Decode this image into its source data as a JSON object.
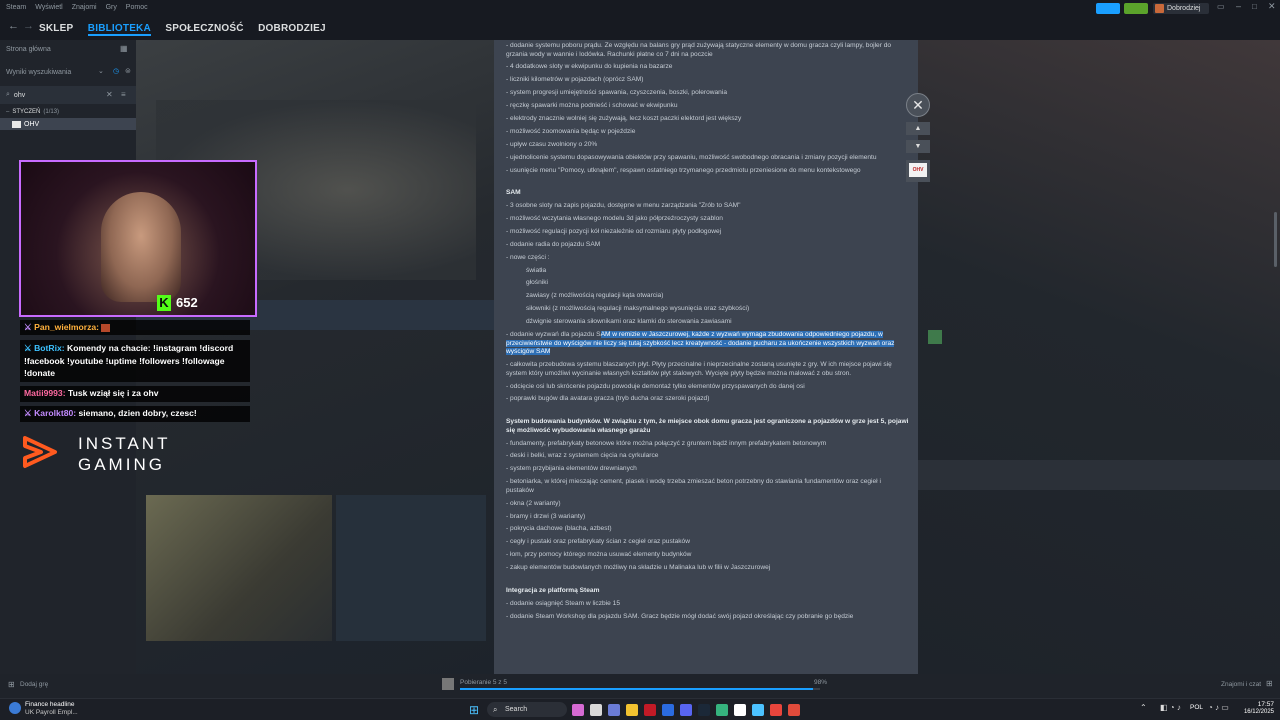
{
  "titlebar": {
    "menu": [
      "Steam",
      "Wyświetl",
      "Znajomi",
      "Gry",
      "Pomoc"
    ],
    "user": "Dobrodziej"
  },
  "nav": {
    "tabs": [
      "SKLEP",
      "BIBLIOTEKA",
      "SPOŁECZNOŚĆ",
      "DOBRODZIEJ"
    ]
  },
  "sidebar": {
    "home": "Strona główna",
    "results": "Wyniki wyszukiwania",
    "search_value": "ohv",
    "group": "STYCZEŃ",
    "group_count": "(1/13)",
    "game": "OHV",
    "add_game": "Dodaj grę"
  },
  "doc": {
    "lines1": [
      "- dodanie systemu poboru prądu. Ze względu na balans gry prąd zużywają statyczne elementy w domu gracza czyli lampy, bojler do grzania wody w wannie i lodówka. Rachunki płatne co 7 dni na poczcie",
      "- 4 dodatkowe sloty w ekwipunku do kupienia na bazarze",
      "- liczniki kilometrów w pojazdach (oprócz SAM)",
      "- system progresji umiejętności spawania, czyszczenia, boszki, polerowania",
      "- ręczkę spawarki można podnieść i schować w ekwipunku",
      "- elektrody znacznie wolniej się zużywają, lecz koszt paczki elektord jest większy",
      "- możliwość zoomowania będąc w pojeździe",
      "- upływ czasu zwolniony o 20%",
      "- ujednolicenie systemu dopasowywania obiektów przy spawaniu, możliwość swobodnego obracania i zmiany pozycji elementu",
      "- usunięcie menu \"Pomocy, utknąłem\", respawn ostatniego trzymanego przedmiotu przeniesione do menu kontekstowego"
    ],
    "head_sam": "SAM",
    "lines_sam": [
      "- 3 osobne sloty na zapis pojazdu, dostępne w menu zarządzania \"Zrób to SAM\"",
      "- możliwość wczytania własnego modelu 3d jako półprzeźroczysty szablon",
      "- możliwość regulacji pozycji kół niezależnie od rozmiaru płyty podłogowej",
      "- dodanie radia do pojazdu SAM",
      "- nowe części :"
    ],
    "sub_items": [
      "światła",
      "głośniki",
      "zawiasy (z możliwością regulacji kąta otwarcia)",
      "siłowniki (z możliwością regulacji maksymalnego wysunięcia oraz szybkości)",
      "dźwignie sterowania siłownikami oraz klamki do sterowania zawiasami"
    ],
    "sel_pre": "- dodanie wyzwań dla pojazdu S",
    "sel_text": "AM w remizie w Jaszczurowej, każde z wyzwań wymaga zbudowania odpowiedniego pojazdu, w przeciwieństwie do wyścigów nie liczy się tutaj szybkość lecz kreatywność - dodanie pucharu za ukończenie wszystkich wyzwań oraz wyścigów SAM",
    "lines2": [
      "- całkowita przebudowa systemu blaszanych płyt. Płyty przecinalne i nieprzecinalne zostaną usunięte z gry. W ich miejsce pojawi się system który umożliwi wycinanie własnych kształtów płyt stalowych. Wycięte płyty będzie można malować z obu stron.",
      "- odcięcie osi lub skrócenie pojazdu powoduje demontaż tylko elementów przyspawanych do danej osi",
      "- poprawki bugów dla avatara gracza (tryb ducha oraz szeroki pojazd)"
    ],
    "head_build": "System budowania budynków. W związku z tym, że miejsce obok domu gracza jest ograniczone a pojazdów w grze jest 5, pojawi się możliwość wybudowania własnego garażu",
    "lines_build": [
      "- fundamenty, prefabrykaty betonowe które można połączyć z gruntem bądź innym prefabrykatem betonowym",
      "- deski i belki, wraz z systemem cięcia na cyrkularce",
      "- system przybijania elementów drewnianych",
      "- betoniarka, w której mieszając cement, piasek i wodę trzeba zmieszać beton potrzebny do stawiania fundamentów oraz cegieł i pustaków",
      "- okna (2 warianty)",
      "- bramy i drzwi (3 warianty)",
      "- pokrycia dachowe (blacha, azbest)",
      "- cegły i pustaki oraz prefabrykaty ścian z cegieł oraz pustaków",
      "- łom, przy pomocy którego można usuwać elementy budynków",
      "- zakup elementów budowlanych możliwy na składzie u Malinaka lub w filii w Jaszczurowej"
    ],
    "head_steam": "Integracja ze platformą Steam",
    "lines_steam": [
      "- dodanie osiągnięć Steam w liczbie 15",
      "- dodanie Steam Workshop dla pojazdu SAM. Gracz będzie mógł dodać swój pojazd określając czy pobranie go będzie"
    ]
  },
  "stream": {
    "points": "652",
    "chat": [
      {
        "user": "Pan_wielmorza:",
        "text": "",
        "color": "#ffb13d"
      },
      {
        "user": "BotRix:",
        "text": "Komendy na chacie: !instagram !discord !facebook !youtube !uptime !followers !followage !donate",
        "color": "#3dc2ff"
      },
      {
        "user": "Matii9993:",
        "text": "Tusk wziął się i za ohv",
        "color": "#ff6aa1"
      },
      {
        "user": "Karolkt80:",
        "text": "siemano, dzien dobry, czesc!",
        "color": "#c38bff"
      }
    ],
    "sponsor_line1": "INSTANT",
    "sponsor_line2": "GAMING"
  },
  "download": {
    "label": "Pobieranie 5 z 5",
    "percent": "98%",
    "progress": 0.98,
    "friends": "Znajomi i czat"
  },
  "taskbar": {
    "news_title": "Finance headline",
    "news_sub": "UK Payroll Empl...",
    "search": "Search",
    "lang": "POL",
    "time": "17:57",
    "date": "16/12/2025"
  }
}
